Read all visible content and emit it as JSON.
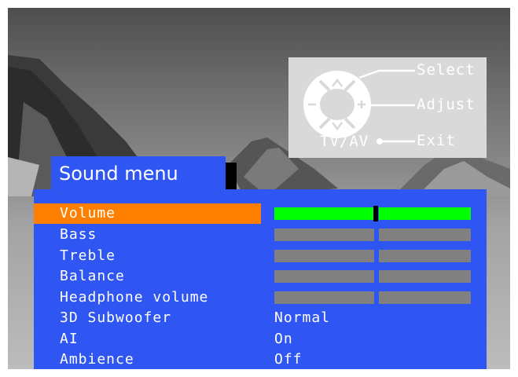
{
  "osd": {
    "title": "Sound menu",
    "items": [
      {
        "label": "Volume",
        "kind": "slider",
        "level": 0.53,
        "selected": true
      },
      {
        "label": "Bass",
        "kind": "slider",
        "selected": false
      },
      {
        "label": "Treble",
        "kind": "slider",
        "selected": false
      },
      {
        "label": "Balance",
        "kind": "slider",
        "selected": false
      },
      {
        "label": "Headphone volume",
        "kind": "slider",
        "selected": false
      },
      {
        "label": "3D Subwoofer",
        "kind": "value",
        "value": "Normal",
        "selected": false
      },
      {
        "label": "AI",
        "kind": "value",
        "value": "On",
        "selected": false
      },
      {
        "label": "Ambience",
        "kind": "value",
        "value": "Off",
        "selected": false
      }
    ]
  },
  "remote_help": {
    "select_label": "Select",
    "adjust_label": "Adjust",
    "exit_label": "Exit",
    "tvav_label": "TV/AV",
    "icons": [
      "up-arrow-icon",
      "down-arrow-icon",
      "minus-icon",
      "plus-icon"
    ]
  },
  "colors": {
    "panel": "#2f56f2",
    "highlight": "#ff8000",
    "active_bar": "#00ff00",
    "inactive_bar": "#808080",
    "remote_box": "#d9d9d9"
  }
}
